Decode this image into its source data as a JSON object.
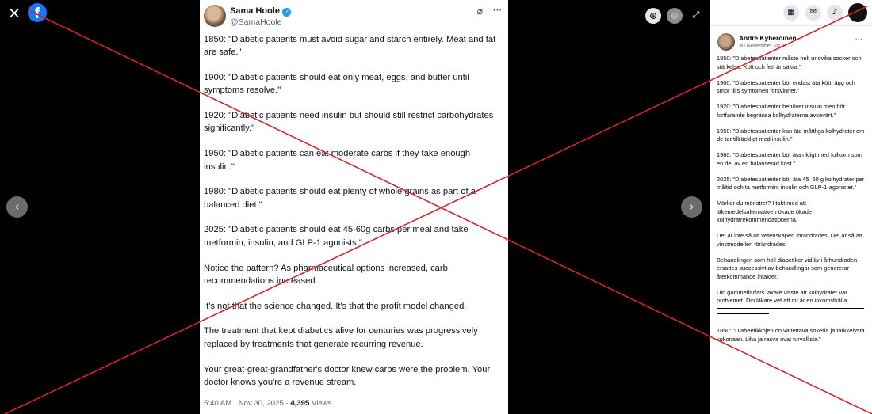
{
  "viewer": {
    "close_icon": "×",
    "brand_letter": "f",
    "zoom_in_icon": "⊕",
    "zoom_out_icon": "⊖",
    "fullscreen_icon": "⤢",
    "prev_icon": "‹",
    "next_icon": "›"
  },
  "tweet": {
    "author": "Sama Hoole",
    "handle": "@SamaHoole",
    "grok_icon": "⌀",
    "more_icon": "···",
    "paragraphs": [
      "1850: \"Diabetic patients must avoid sugar and starch entirely. Meat and fat are safe.\"",
      "1900: \"Diabetic patients should eat only meat, eggs, and butter until symptoms resolve.\"",
      "1920: \"Diabetic patients need insulin but should still restrict carbohydrates significantly.\"",
      "1950: \"Diabetic patients can eat moderate carbs if they take enough insulin.\"",
      "1980: \"Diabetic patients should eat plenty of whole grains as part of a balanced diet.\"",
      "2025: \"Diabetic patients should eat 45-60g carbs per meal and take metformin, insulin, and GLP-1 agonists.\"",
      "Notice the pattern? As pharmaceutical options increased, carb recommendations increased.",
      "It's not that the science changed. It's that the profit model changed.",
      "The treatment that kept diabetics alive for centuries was progressively replaced by treatments that generate recurring revenue.",
      "Your great-great-grandfather's doctor knew carbs were the problem. Your doctor knows you're a revenue stream."
    ],
    "time": "5:40 AM · Nov 30, 2025 · ",
    "views_count": "4,395",
    "views_label": " Views"
  },
  "panel": {
    "top_icons": [
      "▦",
      "✉",
      "♪"
    ],
    "author": "André Kyheröinen",
    "date": "30 November 2025 · ◌",
    "more_icon": "···",
    "paragraphs": [
      "1850: \"Diabetespatienter måste helt undvika socker och stärkelse. Kött och fett är säkra.\"",
      "1900: \"Diabetespatienter bör endast äta kött, ägg och smör tills symtomen försvinner.\"",
      "1920: \"Diabetespatienter behöver insulin men bör fortfarande begränsa kolhydraterna avsevärt.\"",
      "1950: \"Diabetespatienter kan äta måttliga kolhydrater om de tar tillräckligt med insulin.\"",
      "1980: \"Diabetespatienter bör äta rikligt med fullkorn som en del av en balanserad kost.\"",
      "2025: \"Diabetespatienter bör äta 45–60 g kolhydrater per måltid och ta metformin, insulin och GLP-1-agonister.\"",
      "Märker du mönstret? I takt med att läkemedelsalternativen ökade ökade kolhydratrekommendationerna.",
      "Det är inte så att vetenskapen förändrades. Det är så att vinstmodellen förändrades.",
      "Behandlingen som höll diabetiker vid liv i århundraden ersattes successivt av behandlingar som genererar återkommande intäkter.",
      "Din gammelfarfars läkare visste att kolhydrater var problemet. Din läkare vet att du är en inkomstkälla.",
      "1850: \"Diabeetikkojen on vältettävä sokeria ja tärkkelystä kokonaan. Liha ja rasva ovat turvallisia.\""
    ]
  },
  "colors": {
    "overlay_line": "#d8232a",
    "facebook_blue": "#1877f2",
    "verified_blue": "#1d9bf0"
  }
}
